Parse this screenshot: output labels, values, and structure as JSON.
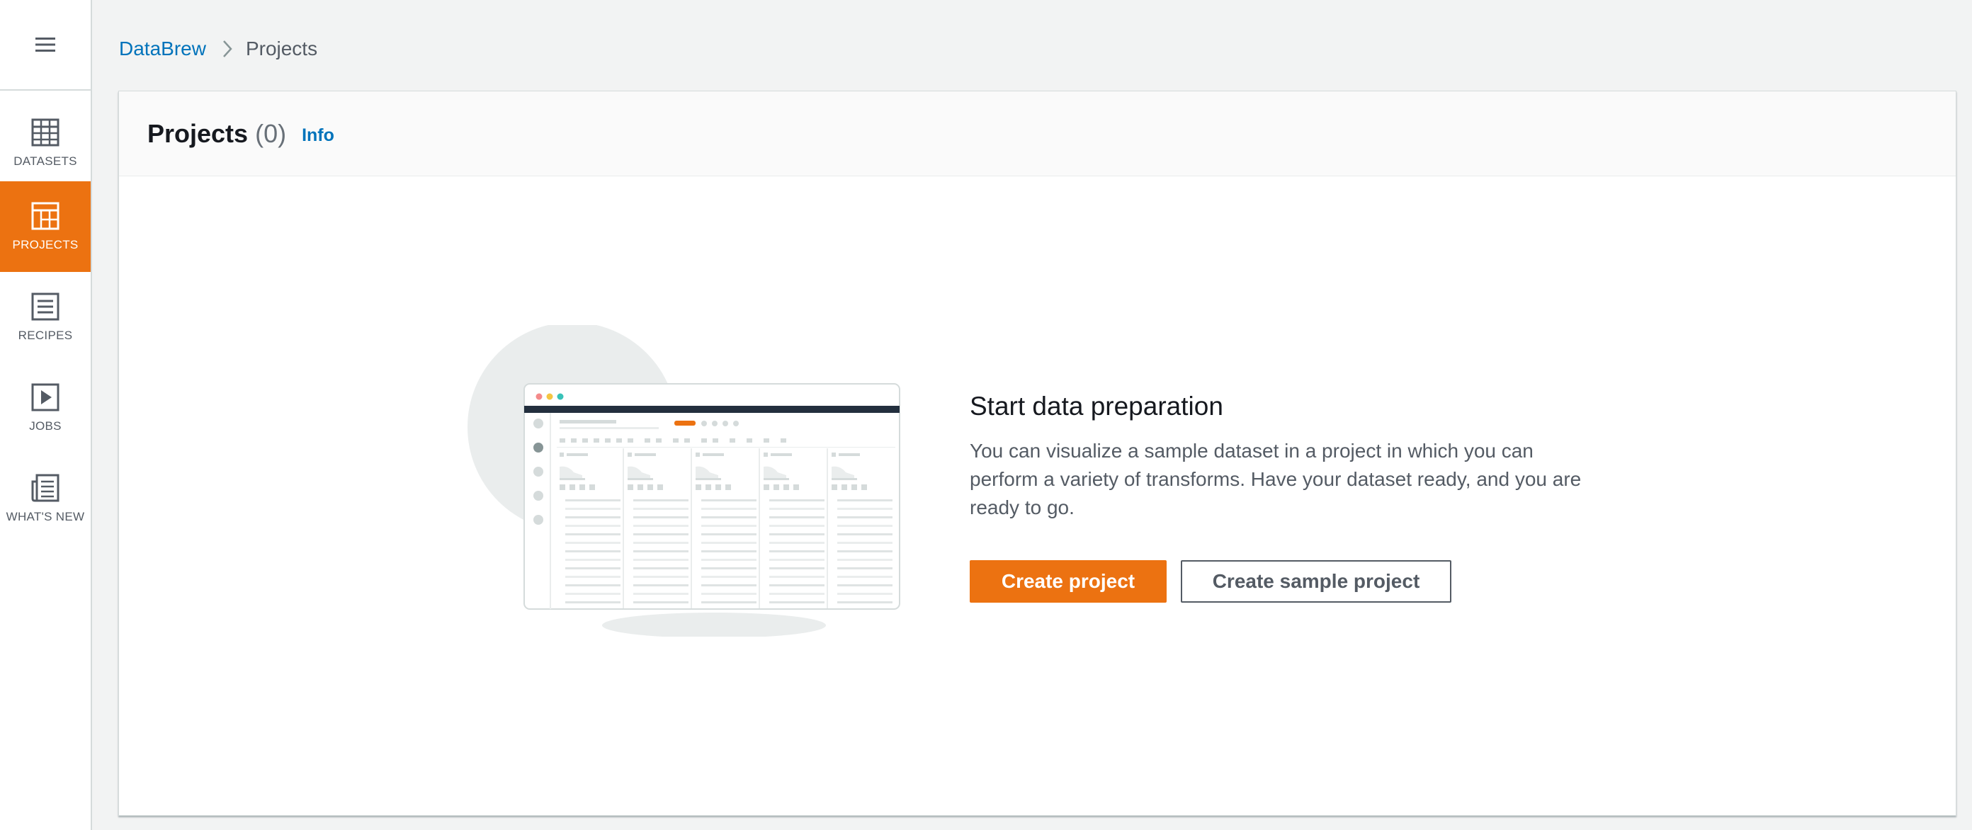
{
  "sidebar": {
    "menu_icon": "hamburger-menu-icon",
    "items": [
      {
        "label": "DATASETS",
        "icon": "table-grid-icon",
        "active": false
      },
      {
        "label": "PROJECTS",
        "icon": "project-grid-icon",
        "active": true
      },
      {
        "label": "RECIPES",
        "icon": "recipe-list-icon",
        "active": false
      },
      {
        "label": "JOBS",
        "icon": "play-icon",
        "active": false
      },
      {
        "label": "WHAT'S NEW",
        "icon": "newspaper-icon",
        "active": false
      }
    ]
  },
  "breadcrumb": {
    "root": "DataBrew",
    "separator_icon": "chevron-right-icon",
    "current": "Projects"
  },
  "header": {
    "title": "Projects",
    "count": "(0)",
    "info": "Info"
  },
  "empty_state": {
    "illustration_icon": "app-window-illustration",
    "title": "Start data preparation",
    "description": "You can visualize a sample dataset in a project in which you can perform a variety of transforms. Have your dataset ready, and you are ready to go.",
    "primary_button": "Create project",
    "secondary_button": "Create sample project"
  },
  "colors": {
    "accent": "#ec7211",
    "link": "#0073bb",
    "background": "#f2f3f3"
  }
}
